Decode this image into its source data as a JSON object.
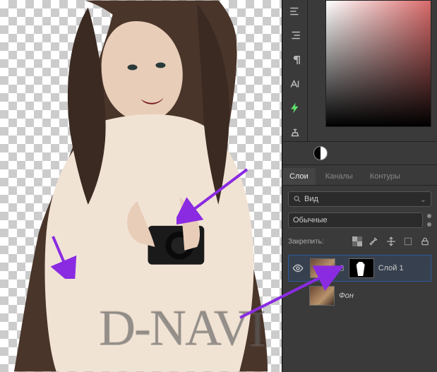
{
  "tabs": {
    "layers": "Слои",
    "channels": "Каналы",
    "paths": "Контуры"
  },
  "filter": {
    "kind": "Вид"
  },
  "blend": {
    "mode": "Обычные"
  },
  "lock": {
    "label": "Закрепить:"
  },
  "layers": {
    "item1": "Слой 1",
    "item2": "Фон"
  },
  "watermark": "D-NAVI"
}
